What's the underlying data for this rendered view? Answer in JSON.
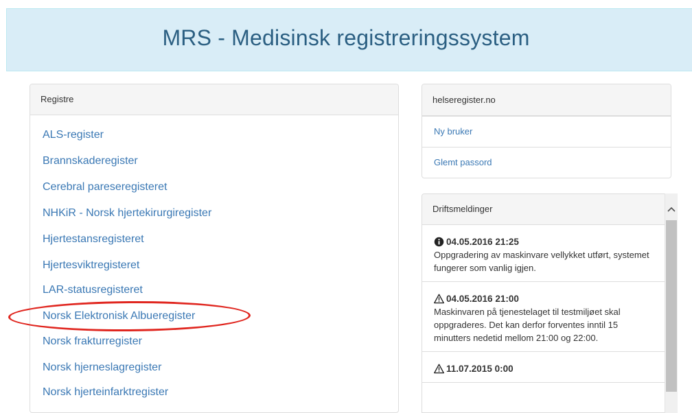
{
  "header": {
    "title": "MRS - Medisinsk registreringssystem"
  },
  "registries": {
    "heading": "Registre",
    "items": [
      "ALS-register",
      "Brannskaderegister",
      "Cerebral pareseregisteret",
      "NHKiR - Norsk hjertekirurgiregister",
      "Hjertestansregisteret",
      "Hjertesviktregisteret",
      "LAR-statusregisteret",
      "Norsk Elektronisk Albueregister",
      "Norsk frakturregister",
      "Norsk hjerneslagregister",
      "Norsk hjerteinfarktregister"
    ],
    "highlighted_item": "Norsk Elektronisk Albueregister"
  },
  "helseregister": {
    "heading": "helseregister.no",
    "links": [
      "Ny bruker",
      "Glemt passord"
    ]
  },
  "driftsmeldinger": {
    "heading": "Driftsmeldinger",
    "messages": [
      {
        "icon": "info-circle-icon",
        "timestamp": "04.05.2016 21:25",
        "text": "Oppgradering av maskinvare vellykket utført, systemet fungerer som vanlig igjen."
      },
      {
        "icon": "warning-triangle-icon",
        "timestamp": "04.05.2016 21:00",
        "text": "Maskinvaren på tjenestelaget til testmiljøet skal oppgraderes. Det kan derfor forventes inntil 15 minutters nedetid mellom 21:00 og 22:00."
      },
      {
        "icon": "warning-triangle-icon",
        "timestamp": "11.07.2015 0:00",
        "text": ""
      }
    ]
  },
  "colors": {
    "header_bg": "#d9edf7",
    "header_text": "#2b5f82",
    "link": "#3a78b4",
    "highlight_ring": "#e0261f"
  }
}
